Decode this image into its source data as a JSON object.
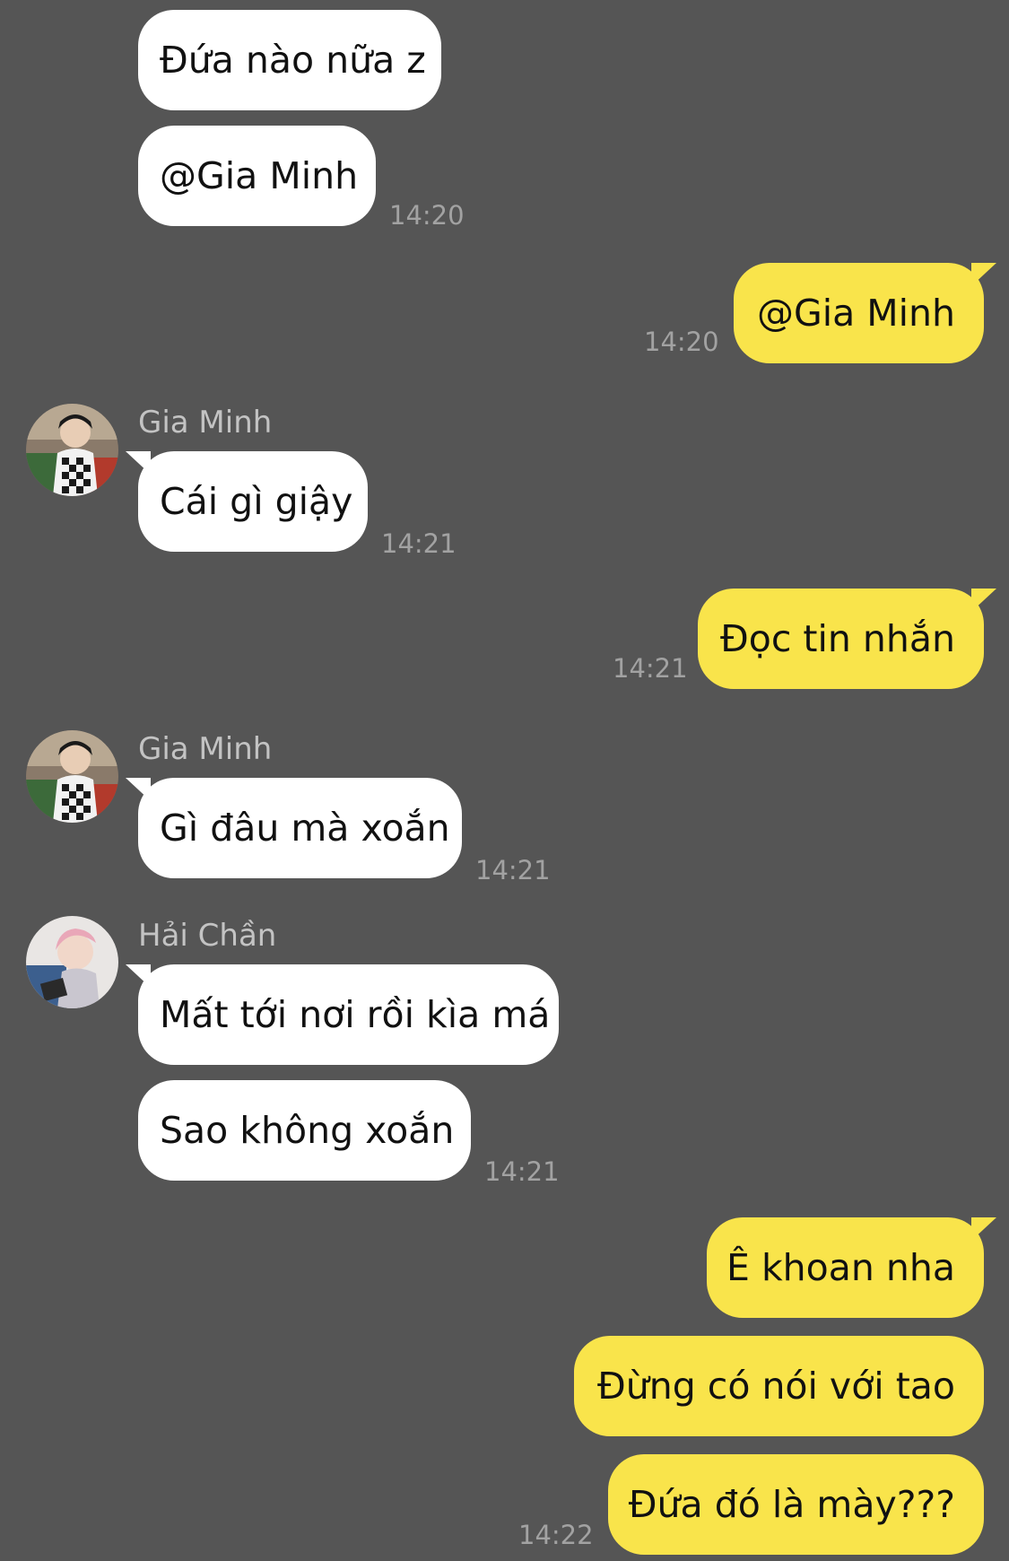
{
  "colors": {
    "background": "#555555",
    "incoming_bubble": "#ffffff",
    "outgoing_bubble": "#f9e44b",
    "timestamp": "#a2a2a2",
    "sender_name": "#c3c3c3"
  },
  "messages": {
    "g1": {
      "text1": "Đứa nào nữa z",
      "text2": "@Gia Minh",
      "time": "14:20"
    },
    "o1": {
      "text": "@Gia Minh",
      "time": "14:20"
    },
    "g2": {
      "sender": "Gia Minh",
      "avatar_icon": "user-avatar-icon",
      "text": "Cái gì giậy",
      "time": "14:21"
    },
    "o2": {
      "text": "Đọc tin nhắn",
      "time": "14:21"
    },
    "g3": {
      "sender": "Gia Minh",
      "avatar_icon": "user-avatar-icon",
      "text": "Gì đâu mà xoắn",
      "time": "14:21"
    },
    "g4": {
      "sender": "Hải Chần",
      "avatar_icon": "user-avatar-icon",
      "text1": "Mất tới nơi rồi kìa má",
      "text2": "Sao không xoắn",
      "time": "14:21"
    },
    "o3": {
      "text1": "Ê khoan nha",
      "text2": "Đừng có nói với tao",
      "text3": "Đứa đó là mày???",
      "time": "14:22"
    }
  }
}
